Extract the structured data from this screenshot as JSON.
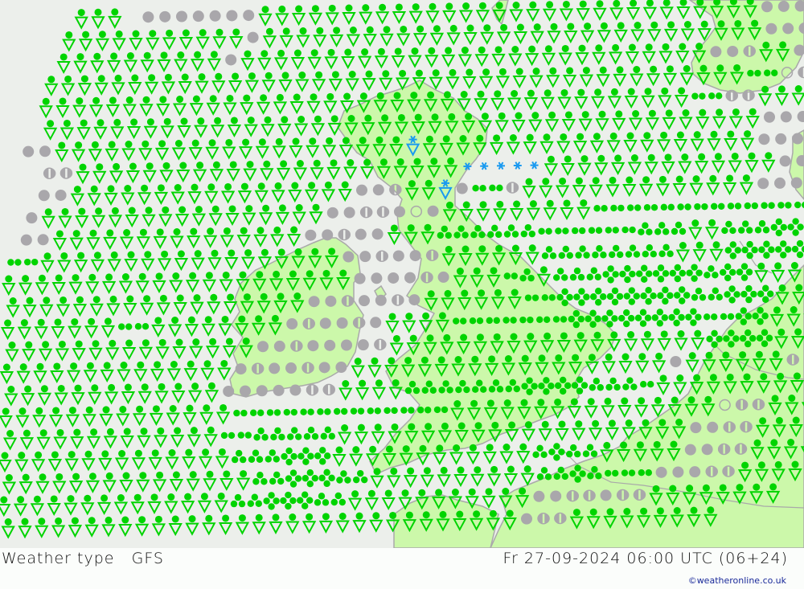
{
  "header": {
    "title": "Weather type   GFS",
    "valid_time": "Fr 27-09-2024 06:00 UTC (06+24)",
    "credit": "©weatheronline.co.uk"
  },
  "colors": {
    "sea": "#ecefeb",
    "land": "#ccf8aa",
    "coast": "#a9a9a9",
    "rain": "#00d400",
    "cloud": "#a9a7ab",
    "snow": "#1a9af0"
  },
  "legend_codes": {
    "S": "rain-shower",
    "r": "light-rain",
    "R": "moderate-rain",
    "H": "heavy-rain",
    "o": "overcast",
    "h": "partly-cloudy",
    "c": "clear",
    "Z": "snow-shower",
    "z": "snow"
  },
  "grid": [
    "....SSS.oooooooSSSSSSSSSSSSSSSSSSSSSSSSSSSSSSooooo",
    "...SSSSSSSSSSSoSSSSSSSSSSSSSSSSSSSSSSSSSSSSSSoohcco",
    "...SSSSSSSSSSoSSSSSSSSSSSSSSSSSSSSSSSSSSSSoohSSooooo",
    "..SSSSSSSSSSSSSSSSSSSSSSSSSSSSSSSSSSSSSSSSSSrrchSSoooo",
    "..SSSSSSSSSSSSSSSSSSSSSSSSSSSSSSSSSSSSSSSrrhhSSSSooooo",
    "..SSSSSSSSSSSSSSSSSSSSSSSSSSSSSSSSSSSSSSSSSSSoooooooo",
    ".ooSSSSSSSSSSSSSSSSSSSSSZSSSSSSSSSSSSSSSSSSSSoooooo",
    "..hhSSSSSSSSSSSSSSSSSSSSSSSzzzzzSSSSSSSSSSSSSSooooo",
    "..ooSSSSSSSSSSSSSSSSSoohSSZorrhSSSSSSSSSSSSSSoooooo",
    ".oSSSSSSSSSSSSSSSSSoohhocoSSSSSSSSSrrrrrrrrrrrrrRRR",
    ".ooSSSSSSSSSSSSSSSoohooSSSRRRRRRrrrrrrRRRSSRRRHH",
    "rrSSSSSSSSSSSSSSSSSSoohoohSSSSSSRRRRRRRRSSSHHHHH",
    "SSSSSSSSSSSSSSSSSSSSSoooohoSSSrRSRRRHHHHHHRHHSSSSS",
    "SSSSSSSSSSSSSSSSSSoohoohoSSSSSSrrHHHHHHHHRRHHHSSSS",
    "SSSSSSSrrSSSSSSSSohoohoSSSSrrrrrrrHHHHHHHHrrHHSSSS",
    "SSSSSSSSSSSSSSSoohoooohSSSSSSSSSSSSSSSSSSSHHHHSSSS",
    "SSSSSSSSSSSSSSohoohooSSSSSSSSSSSSSSSSSSSoSSSSSShoS",
    "SSSSSSSSSSSSSooooohhSSSSRRRRRRRHHHHRRRrSSSSSSSSSS",
    "SSSSSSSSSSSSSSrrrrrrrrrrrrrSSSSSSSSSSSSSSSSchhSSS",
    "SSSSSSSSSSSSSrrRRRRRSSSSSSSSSSSSSSSSSSSSSoohhSSSS",
    "SSSSSSSSSSSSSSRRRHHHSSSSSSSSSSSSRHRRSSSSSoohhSSSS",
    "SSSSSSSSSSSSSSSRRHHHRRSSSSSSSSSSRRHRrrrooohhSSSS",
    "SSSSSSSSSSSSSSRRHHHRRSSSSSSSSSSSoohhohhSSSSSSSS",
    "SSSSSSSSSSSSSSSSSSSSSSSSSSSSSSSohhSSSSSSSSS"
  ]
}
